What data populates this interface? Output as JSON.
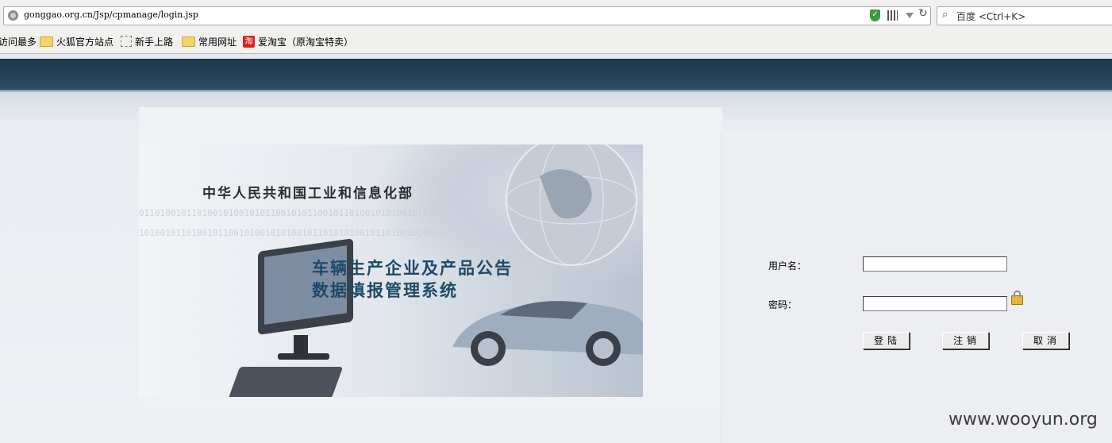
{
  "browser": {
    "url": "gonggao.org.cn/Jsp/cpmanage/login.jsp",
    "search_placeholder": "百度 <Ctrl+K>",
    "bookmarks": [
      "访问最多",
      "火狐官方站点",
      "新手上路",
      "常用网址",
      "爱淘宝（原淘宝特卖）"
    ],
    "taobao_glyph": "淘"
  },
  "banner": {
    "ministry": "中华人民共和国工业和信息化部",
    "title_line1": "车辆生产企业及产品公告",
    "title_line2": "数据填报管理系统"
  },
  "login": {
    "username_label": "用户名：",
    "password_label": "密码：",
    "username_value": "",
    "password_value": "",
    "login_button": "登陆",
    "logout_button": "注销",
    "cancel_button": "取消"
  },
  "watermark": "www.wooyun.org",
  "colors": {
    "header_band": "#1d3548",
    "title_text": "#1f4a67"
  },
  "icons": [
    "globe-icon",
    "shield-icon",
    "qr-code-icon",
    "dropdown-arrow-icon",
    "reload-icon",
    "search-icon",
    "folder-icon",
    "page-icon",
    "taobao-icon",
    "lock-icon"
  ]
}
